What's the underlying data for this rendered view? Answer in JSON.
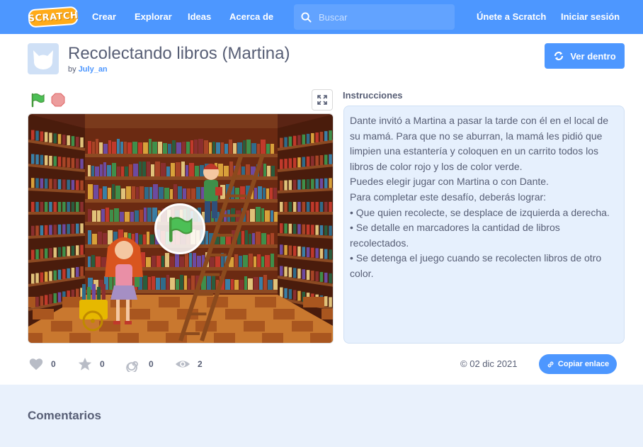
{
  "nav": {
    "logo_text": "SCRATCH",
    "links": [
      "Crear",
      "Explorar",
      "Ideas",
      "Acerca de"
    ],
    "search_placeholder": "Buscar",
    "join_label": "Únete a Scratch",
    "signin_label": "Iniciar sesión",
    "color": "#4d97ff"
  },
  "project": {
    "title": "Recolectando libros (Martina)",
    "by_prefix": "by",
    "author": "July_an",
    "see_inside_label": "Ver dentro"
  },
  "instructions": {
    "heading": "Instrucciones",
    "text": "Dante invitó a Martina a pasar la tarde con él en el local de su mamá. Para que no se aburran, la mamá les pidió que limpien una estantería y coloquen en un carrito todos los libros de color rojo y los de color verde.\nPuedes elegir jugar con Martina o con Dante.\nPara completar este desafío, deberás lograr:\n• Que quien recolecte, se desplace de izquierda a derecha.\n• Se detalle en marcadores la cantidad de libros recolectados.\n• Se detenga el juego cuando se recolecten libros de otro color."
  },
  "stats": {
    "loves": "0",
    "favorites": "0",
    "remixes": "0",
    "views": "2"
  },
  "date": "02 dic 2021",
  "copy_link_label": "Copiar enlace",
  "comments_heading": "Comentarios",
  "icons": {
    "green_flag": "green-flag-icon",
    "stop": "stop-icon",
    "fullscreen": "fullscreen-icon",
    "search": "search-icon",
    "see_inside": "remix-arrows-icon",
    "heart": "heart-icon",
    "star": "star-icon",
    "remix": "spiral-icon",
    "eye": "eye-icon",
    "link": "link-icon",
    "copyright": "copyright-icon"
  }
}
